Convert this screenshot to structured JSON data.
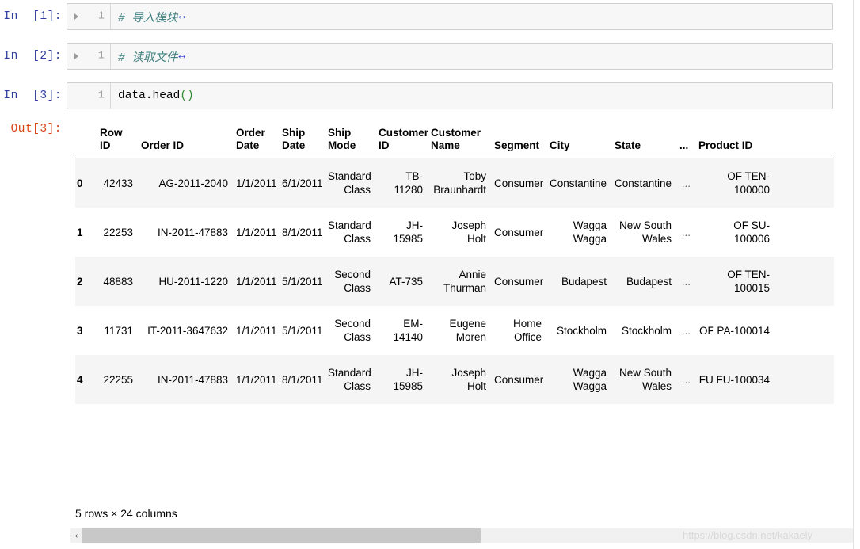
{
  "cells": [
    {
      "prompt": "In  [1]:",
      "line_number": "1",
      "has_fold_marker": true,
      "code_comment": "# 导入模块",
      "code_arrow": "↔"
    },
    {
      "prompt": "In  [2]:",
      "line_number": "1",
      "has_fold_marker": true,
      "code_comment": "# 读取文件",
      "code_arrow": "↔"
    },
    {
      "prompt": "In  [3]:",
      "line_number": "1",
      "has_fold_marker": false,
      "code_text": "data.head",
      "code_paren": "()"
    }
  ],
  "output": {
    "prompt": "Out[3]:",
    "shape_label": "5 rows × 24 columns",
    "columns": [
      "",
      "Row ID",
      "Order ID",
      "Order Date",
      "Ship Date",
      "Ship Mode",
      "Customer ID",
      "Customer Name",
      "Segment",
      "City",
      "State",
      "...",
      "Product ID"
    ],
    "rows": [
      {
        "index": "0",
        "row_id": "42433",
        "order_id": "AG-2011-2040",
        "order_date": "1/1/2011",
        "ship_date": "6/1/2011",
        "ship_mode": "Standard Class",
        "customer_id": "TB-11280",
        "customer_name": "Toby Braunhardt",
        "segment": "Consumer",
        "city": "Constantine",
        "state": "Constantine",
        "ellipsis": "...",
        "product_id": "OF TEN-100000"
      },
      {
        "index": "1",
        "row_id": "22253",
        "order_id": "IN-2011-47883",
        "order_date": "1/1/2011",
        "ship_date": "8/1/2011",
        "ship_mode": "Standard Class",
        "customer_id": "JH-15985",
        "customer_name": "Joseph Holt",
        "segment": "Consumer",
        "city": "Wagga Wagga",
        "state": "New South Wales",
        "ellipsis": "...",
        "product_id": "OF SU-100006"
      },
      {
        "index": "2",
        "row_id": "48883",
        "order_id": "HU-2011-1220",
        "order_date": "1/1/2011",
        "ship_date": "5/1/2011",
        "ship_mode": "Second Class",
        "customer_id": "AT-735",
        "customer_name": "Annie Thurman",
        "segment": "Consumer",
        "city": "Budapest",
        "state": "Budapest",
        "ellipsis": "...",
        "product_id": "OF TEN-100015"
      },
      {
        "index": "3",
        "row_id": "11731",
        "order_id": "IT-2011-3647632",
        "order_date": "1/1/2011",
        "ship_date": "5/1/2011",
        "ship_mode": "Second Class",
        "customer_id": "EM-14140",
        "customer_name": "Eugene Moren",
        "segment": "Home Office",
        "city": "Stockholm",
        "state": "Stockholm",
        "ellipsis": "...",
        "product_id": "OF PA-100014"
      },
      {
        "index": "4",
        "row_id": "22255",
        "order_id": "IN-2011-47883",
        "order_date": "1/1/2011",
        "ship_date": "8/1/2011",
        "ship_mode": "Standard Class",
        "customer_id": "JH-15985",
        "customer_name": "Joseph Holt",
        "segment": "Consumer",
        "city": "Wagga Wagga",
        "state": "New South Wales",
        "ellipsis": "...",
        "product_id": "FU FU-100034"
      }
    ]
  },
  "scrollbar": {
    "left_arrow": "‹",
    "right_arrow": "›",
    "thumb_percent": 52
  },
  "watermark": "https://blog.csdn.net/kakaely",
  "colors": {
    "in_prompt": "#303F9F",
    "out_prompt": "#D84315",
    "comment": "#408080",
    "cell_background": "#f7f7f7",
    "cell_border": "#cfcfcf",
    "stripe": "#f5f5f5"
  }
}
